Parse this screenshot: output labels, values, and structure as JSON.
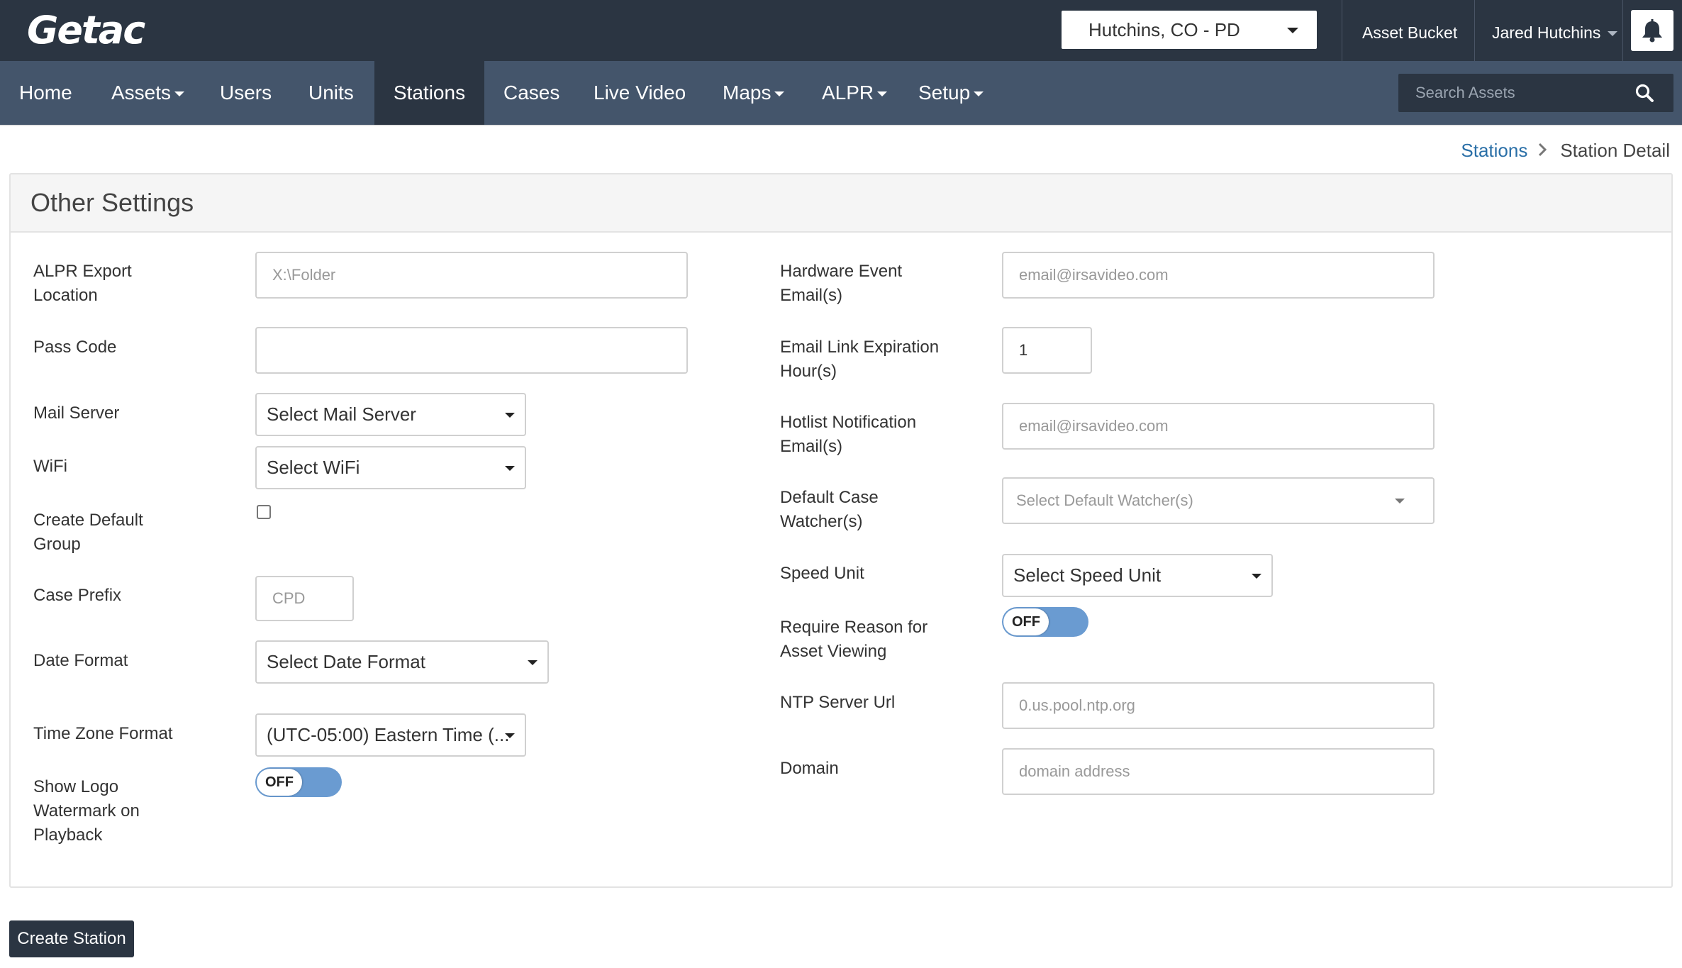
{
  "app": {
    "logo": "Getac"
  },
  "topbar": {
    "agency": "Hutchins, CO - PD",
    "asset_bucket": "Asset Bucket",
    "user": "Jared Hutchins"
  },
  "nav": {
    "items": [
      {
        "label": "Home"
      },
      {
        "label": "Assets"
      },
      {
        "label": "Users"
      },
      {
        "label": "Units"
      },
      {
        "label": "Stations"
      },
      {
        "label": "Cases"
      },
      {
        "label": "Live Video"
      },
      {
        "label": "Maps"
      },
      {
        "label": "ALPR"
      },
      {
        "label": "Setup"
      }
    ],
    "active": "Stations",
    "search_placeholder": "Search Assets"
  },
  "breadcrumb": {
    "parent": "Stations",
    "current": "Station Detail"
  },
  "panel": {
    "title": "Other Settings",
    "left": {
      "alpr_export_label": "ALPR Export Location",
      "alpr_export_line1": "ALPR Export",
      "alpr_export_line2": "Location",
      "alpr_export_placeholder": "X:\\Folder",
      "pass_code_label": "Pass Code",
      "pass_code_value": "",
      "mail_server_label": "Mail Server",
      "mail_server_value": "Select Mail Server",
      "wifi_label": "WiFi",
      "wifi_value": "Select WiFi",
      "create_group_line1": "Create Default",
      "create_group_line2": "Group",
      "create_group_checked": false,
      "case_prefix_label": "Case Prefix",
      "case_prefix_placeholder": "CPD",
      "date_format_label": "Date Format",
      "date_format_value": "Select Date Format",
      "timezone_label": "Time Zone Format",
      "timezone_value": "(UTC-05:00) Eastern Time (...",
      "logo_watermark_line1": "Show Logo",
      "logo_watermark_line2": "Watermark on",
      "logo_watermark_line3": "Playback",
      "logo_watermark_state": "OFF"
    },
    "right": {
      "hardware_email_line1": "Hardware Event",
      "hardware_email_line2": "Email(s)",
      "hardware_email_placeholder": "email@irsavideo.com",
      "link_expiration_line1": "Email Link Expiration",
      "link_expiration_line2": "Hour(s)",
      "link_expiration_value": "1",
      "hotlist_line1": "Hotlist Notification",
      "hotlist_line2": "Email(s)",
      "hotlist_placeholder": "email@irsavideo.com",
      "watcher_line1": "Default Case",
      "watcher_line2": "Watcher(s)",
      "watcher_placeholder": "Select Default Watcher(s)",
      "speed_unit_label": "Speed Unit",
      "speed_unit_value": "Select Speed Unit",
      "reason_line1": "Require Reason for",
      "reason_line2": "Asset Viewing",
      "reason_state": "OFF",
      "ntp_label": "NTP Server Url",
      "ntp_placeholder": "0.us.pool.ntp.org",
      "domain_label": "Domain",
      "domain_placeholder": "domain address"
    }
  },
  "actions": {
    "create_station": "Create Station"
  },
  "colors": {
    "topbar": "#2b3542",
    "navbar": "#44556b",
    "toggle": "#6a9bd1",
    "link": "#2a6fa7",
    "icons": [
      "search-icon",
      "bell-icon",
      "chevron-right-icon",
      "caret-down-icon"
    ]
  }
}
